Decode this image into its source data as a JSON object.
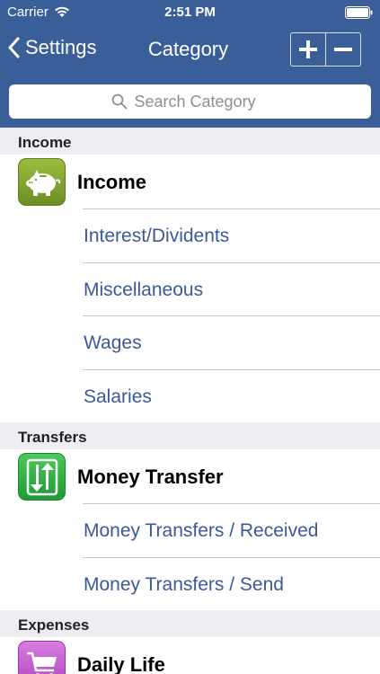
{
  "status": {
    "carrier": "Carrier",
    "time": "2:51 PM"
  },
  "nav": {
    "back_label": "Settings",
    "title": "Category"
  },
  "search": {
    "placeholder": "Search Category"
  },
  "colors": {
    "nav_bg": "#3a5e98",
    "link": "#3b5998",
    "section_bg": "#ededf2"
  },
  "sections": [
    {
      "header": "Income",
      "parent": {
        "label": "Income",
        "icon": "piggy-bank-icon",
        "color": "#7da22b"
      },
      "children": [
        "Interest/Dividents",
        "Miscellaneous",
        "Wages",
        "Salaries"
      ]
    },
    {
      "header": "Transfers",
      "parent": {
        "label": "Money Transfer",
        "icon": "transfer-arrows-icon",
        "color": "#39b44a"
      },
      "children": [
        "Money Transfers / Received",
        "Money Transfers / Send"
      ]
    },
    {
      "header": "Expenses",
      "parent": {
        "label": "Daily Life",
        "icon": "shopping-cart-icon",
        "color": "#c057c9"
      },
      "children": []
    }
  ]
}
